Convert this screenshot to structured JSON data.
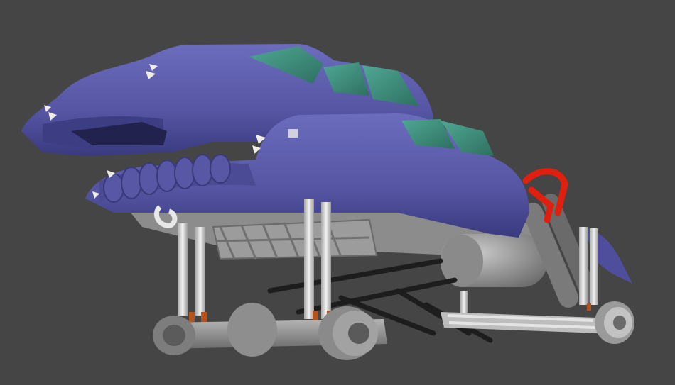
{
  "scene": {
    "subject": "monster-truck-3d-model",
    "colors": {
      "background": "#454545",
      "body_paint": "#5b5ba8",
      "body_shade": "#3f3f86",
      "glass": "#3d8f7d",
      "chrome": "#d8d8d8",
      "chassis": "#8f8f8f",
      "chassis_dark": "#5e5e5e",
      "rollcage": "#e0200f",
      "link_black": "#1c1c1c"
    }
  }
}
